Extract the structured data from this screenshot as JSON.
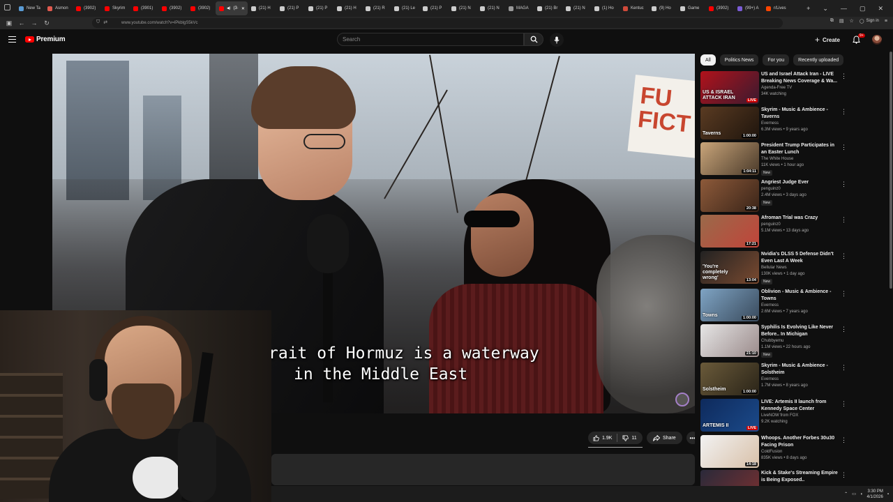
{
  "browser": {
    "tabs": [
      {
        "label": "New Ta",
        "color": "#5a9bd4"
      },
      {
        "label": "Asmon",
        "color": "#e05a4f"
      },
      {
        "label": "(3902)",
        "color": "#ff0000"
      },
      {
        "label": "Skyrim",
        "color": "#ff0000"
      },
      {
        "label": "(3901)",
        "color": "#ff0000"
      },
      {
        "label": "(3902)",
        "color": "#ff0000"
      },
      {
        "label": "(3902)",
        "color": "#ff0000"
      },
      {
        "label": "(3·",
        "color": "#ff0000"
      },
      {
        "label": "(21) H",
        "color": "#cccccc"
      },
      {
        "label": "(21) P",
        "color": "#cccccc"
      },
      {
        "label": "(21) P",
        "color": "#cccccc"
      },
      {
        "label": "(21) H",
        "color": "#cccccc"
      },
      {
        "label": "(21) R",
        "color": "#cccccc"
      },
      {
        "label": "(21) Le",
        "color": "#cccccc"
      },
      {
        "label": "(21) P",
        "color": "#cccccc"
      },
      {
        "label": "(21) N",
        "color": "#cccccc"
      },
      {
        "label": "(21) N",
        "color": "#cccccc"
      },
      {
        "label": "MAGA",
        "color": "#999999"
      },
      {
        "label": "(21) Br",
        "color": "#cccccc"
      },
      {
        "label": "(21) N",
        "color": "#cccccc"
      },
      {
        "label": "(1) Ho",
        "color": "#cccccc"
      },
      {
        "label": "Kentuc",
        "color": "#d04a3a"
      },
      {
        "label": "(9) Ho",
        "color": "#cccccc"
      },
      {
        "label": "Game",
        "color": "#cccccc"
      },
      {
        "label": "(3902)",
        "color": "#ff0000"
      },
      {
        "label": "(99+) A",
        "color": "#7b5cd6"
      },
      {
        "label": "r/Lives",
        "color": "#ff4500"
      }
    ],
    "active_tab_index": 7,
    "url": "www.youtube.com/watch?v=lPkblgS5kVc",
    "sign_in_label": "Sign in"
  },
  "youtube": {
    "brand": "Premium",
    "search_placeholder": "Search",
    "create_label": "Create",
    "notification_count": "9+"
  },
  "player": {
    "caption_line1": "rait of Hormuz is a waterway",
    "caption_line2": "in the Middle East",
    "sign_text": "FU\nFICT"
  },
  "actions": {
    "like_count": "1.9K",
    "dislike_count": "11",
    "share_label": "Share"
  },
  "sidebar": {
    "chips": [
      "All",
      "Politics News",
      "For you",
      "Recently uploaded"
    ],
    "active_chip": "All",
    "recommendations": [
      {
        "title": "US and Israel Attack Iran - LIVE Breaking News Coverage & Wa...",
        "channel": "Agenda-Free TV",
        "meta": "34K watching",
        "badge": "LIVE",
        "new": false,
        "thumb_text": "US & ISRAEL ATTACK IRAN",
        "thumb_bg": "linear-gradient(135deg,#b1121b,#3b1a2f)"
      },
      {
        "title": "Skyrim - Music & Ambience - Taverns",
        "channel": "Everness",
        "meta": "6.3M views • 9 years ago",
        "badge": "1:00:00",
        "new": false,
        "thumb_text": "Taverns",
        "thumb_bg": "linear-gradient(135deg,#5a3b22,#1f150d)"
      },
      {
        "title": "President Trump Participates in an Easter Lunch",
        "channel": "The White House",
        "meta": "11K views • 1 hour ago",
        "badge": "1:04:11",
        "new": true,
        "thumb_text": "",
        "thumb_bg": "linear-gradient(135deg,#c9a57a,#4a3a2a)"
      },
      {
        "title": "Angriest Judge Ever",
        "channel": "penguinz0",
        "meta": "2.4M views • 3 days ago",
        "badge": "20:38",
        "new": true,
        "thumb_text": "",
        "thumb_bg": "linear-gradient(135deg,#8d5a3a,#3a2418)"
      },
      {
        "title": "Afroman Trial was Crazy",
        "channel": "penguinz0",
        "meta": "5.1M views • 13 days ago",
        "badge": "17:21",
        "new": false,
        "thumb_text": "",
        "thumb_bg": "linear-gradient(135deg,#9a6a4a,#c1443a)"
      },
      {
        "title": "Nvidia's DLSS 5 Defense Didn't Even Last A Week",
        "channel": "Bellular News",
        "meta": "130K views • 1 day ago",
        "badge": "13:04",
        "new": true,
        "thumb_text": "'You're completely wrong'",
        "thumb_bg": "linear-gradient(135deg,#222,#7a4a30)"
      },
      {
        "title": "Oblivion - Music & Ambience - Towns",
        "channel": "Everness",
        "meta": "2.6M views • 7 years ago",
        "badge": "1:00:00",
        "new": false,
        "thumb_text": "Towns",
        "thumb_bg": "linear-gradient(135deg,#7fa4c4,#394a5c)"
      },
      {
        "title": "Syphilis Is Evolving Like Never Before.. In Michigan",
        "channel": "Chubbyemu",
        "meta": "1.1M views • 22 hours ago",
        "badge": "21:10",
        "new": true,
        "thumb_text": "",
        "thumb_bg": "linear-gradient(135deg,#e6e6e6,#9a8a8a)"
      },
      {
        "title": "Skyrim - Music & Ambience - Solstheim",
        "channel": "Everness",
        "meta": "1.7M views • 8 years ago",
        "badge": "1:00:00",
        "new": false,
        "thumb_text": "Solstheim",
        "thumb_bg": "linear-gradient(135deg,#6a5a3a,#2a2418)"
      },
      {
        "title": "LIVE: Artemis II launch from Kennedy Space Center",
        "channel": "LiveNOW from FOX",
        "meta": "9.2K watching",
        "badge": "LIVE",
        "new": false,
        "thumb_text": "ARTEMIS II",
        "thumb_bg": "linear-gradient(135deg,#0e2a5c,#1b4a8a)"
      },
      {
        "title": "Whoops. Another Forbes 30u30 Facing Prison",
        "channel": "ColdFusion",
        "meta": "835K views • 8 days ago",
        "badge": "14:18",
        "new": false,
        "thumb_text": "",
        "thumb_bg": "linear-gradient(135deg,#f2f2f2,#d8c0a8)"
      },
      {
        "title": "Kick & Stake's Streaming Empire is Being Exposed..",
        "channel": "",
        "meta": "",
        "badge": "",
        "new": false,
        "thumb_text": "",
        "thumb_bg": "linear-gradient(135deg,#2a2a3a,#7a3030)"
      }
    ]
  },
  "tray": {
    "time": "3:30 PM",
    "date": "4/1/2026"
  },
  "labels": {
    "new_badge": "New"
  }
}
